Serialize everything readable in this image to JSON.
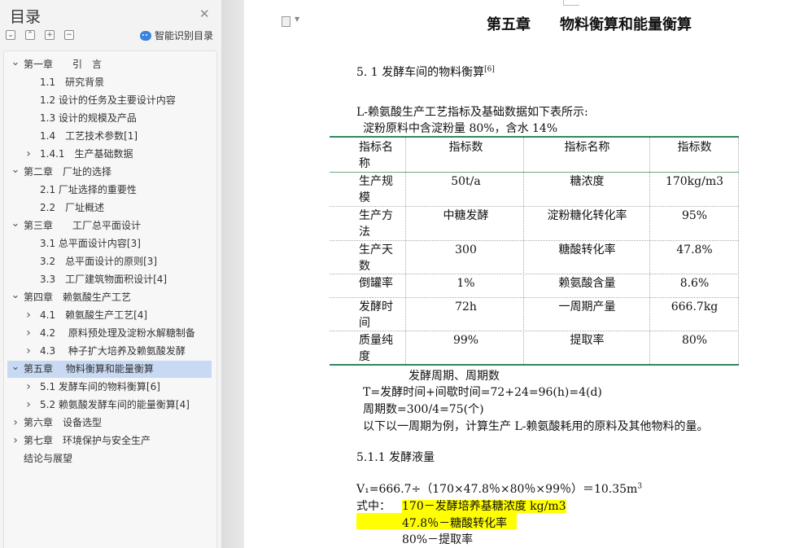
{
  "sidebar": {
    "title": "目录",
    "close_icon": "close-icon",
    "tool_buttons": [
      "expand-all",
      "collapse-all",
      "add",
      "remove"
    ],
    "smart_toc_label": "智能识别目录",
    "items": [
      {
        "label": "第一章　　引　言",
        "level": 0,
        "chevron": "down"
      },
      {
        "label": "1.1　研究背景",
        "level": 1,
        "chevron": ""
      },
      {
        "label": "1.2  设计的任务及主要设计内容",
        "level": 1,
        "chevron": ""
      },
      {
        "label": "1.3  设计的规模及产品",
        "level": 1,
        "chevron": ""
      },
      {
        "label": "1.4　工艺技术参数[1]",
        "level": 1,
        "chevron": ""
      },
      {
        "label": "1.4.1　生产基础数据",
        "level": 1,
        "chevron": "right"
      },
      {
        "label": "第二章　厂址的选择",
        "level": 0,
        "chevron": "down"
      },
      {
        "label": "2.1  厂址选择的重要性",
        "level": 1,
        "chevron": ""
      },
      {
        "label": "2.2　厂址概述",
        "level": 1,
        "chevron": ""
      },
      {
        "label": "第三章　　工厂总平面设计",
        "level": 0,
        "chevron": "down"
      },
      {
        "label": "3.1 总平面设计内容[3]",
        "level": 1,
        "chevron": ""
      },
      {
        "label": "3.2　总平面设计的原则[3]",
        "level": 1,
        "chevron": ""
      },
      {
        "label": "3.3　工厂建筑物面积设计[4]",
        "level": 1,
        "chevron": ""
      },
      {
        "label": "第四章　赖氨酸生产工艺",
        "level": 0,
        "chevron": "down"
      },
      {
        "label": "4.1　赖氨酸生产工艺[4]",
        "level": 1,
        "chevron": "right"
      },
      {
        "label": "4.2　 原料预处理及淀粉水解糖制备",
        "level": 1,
        "chevron": "right"
      },
      {
        "label": "4.3　 种子扩大培养及赖氨酸发酵",
        "level": 1,
        "chevron": "right"
      },
      {
        "label": "第五章　 物料衡算和能量衡算",
        "level": 0,
        "chevron": "down",
        "selected": true
      },
      {
        "label": "5.1 发酵车间的物料衡算[6]",
        "level": 1,
        "chevron": "right"
      },
      {
        "label": "5.2  赖氨酸发酵车间的能量衡算[4]",
        "level": 1,
        "chevron": "right"
      },
      {
        "label": "第六章　设备选型",
        "level": 0,
        "chevron": "right"
      },
      {
        "label": "第七章　环境保护与安全生产",
        "level": 0,
        "chevron": "right"
      },
      {
        "label": "结论与展望",
        "level": 0,
        "chevron": ""
      }
    ]
  },
  "document": {
    "chapter_title": "第五章　　物料衡算和能量衡算",
    "section_title": "5. 1 发酵车间的物料衡算",
    "section_ref": "[6]",
    "intro_line": "L-赖氨酸生产工艺指标及基础数据如下表所示:",
    "starch_line": "淀粉原料中含淀粉量 80%，含水 14%",
    "table": {
      "headers": [
        "指标名称",
        "指标数",
        "指标名称",
        "指标数"
      ],
      "rows": [
        [
          "生产规模",
          "50t/a",
          "糖浓度",
          "170kg/m3"
        ],
        [
          "生产方法",
          "中糖发酵",
          "淀粉糖化转化率",
          "95%"
        ],
        [
          "生产天数",
          "300",
          "糖酸转化率",
          "47.8%"
        ],
        [
          "倒罐率",
          "1%",
          "赖氨酸含量",
          "8.6%"
        ],
        [
          "发酵时间",
          "72h",
          "一周期产量",
          "666.7kg"
        ],
        [
          "质量纯度",
          "99%",
          "提取率",
          "80%"
        ]
      ]
    },
    "cycle_heading": "发酵周期、周期数",
    "t_line": "T=发酵时间+间歇时间=72+24=96(h)=4(d)",
    "cycles_line": "周期数=300/4=75(个)",
    "basis_line": "以下以一周期为例，计算生产  L-赖氨酸耗用的原料及其他物料的量。",
    "subsection_title": "5.1.1 发酵液量",
    "v1_line": "V₁=666.7÷（170×47.8％×80％×99％）＝10.35m",
    "v1_exp": "3",
    "where_label": "式中：",
    "where_1": "170－发酵培养基糖浓度 kg/m3",
    "where_2": "47.8％－糖酸转化率",
    "where_3": "80%－提取率"
  },
  "colors": {
    "table_rule": "#2e8b57",
    "highlight": "#ffff00",
    "selected_toc": "#c7d9f3"
  }
}
